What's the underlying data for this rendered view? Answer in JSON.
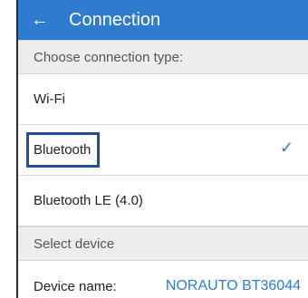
{
  "header": {
    "back_icon": "arrow-left-icon",
    "title": "Connection",
    "color": "#2e7bd0"
  },
  "sections": {
    "connection_type": "Choose connection type:",
    "select_device": "Select device"
  },
  "options": [
    {
      "label": "Wi-Fi",
      "selected": false
    },
    {
      "label": "Bluetooth",
      "selected": true
    },
    {
      "label": "Bluetooth LE (4.0)",
      "selected": false
    }
  ],
  "check_icon": "check-icon",
  "device": {
    "label": "Device name:",
    "value": "NORAUTO BT36044"
  },
  "colors": {
    "accent": "#2e7bd0",
    "highlight_box": "#1e4f9e",
    "section_bg": "#ededed"
  }
}
